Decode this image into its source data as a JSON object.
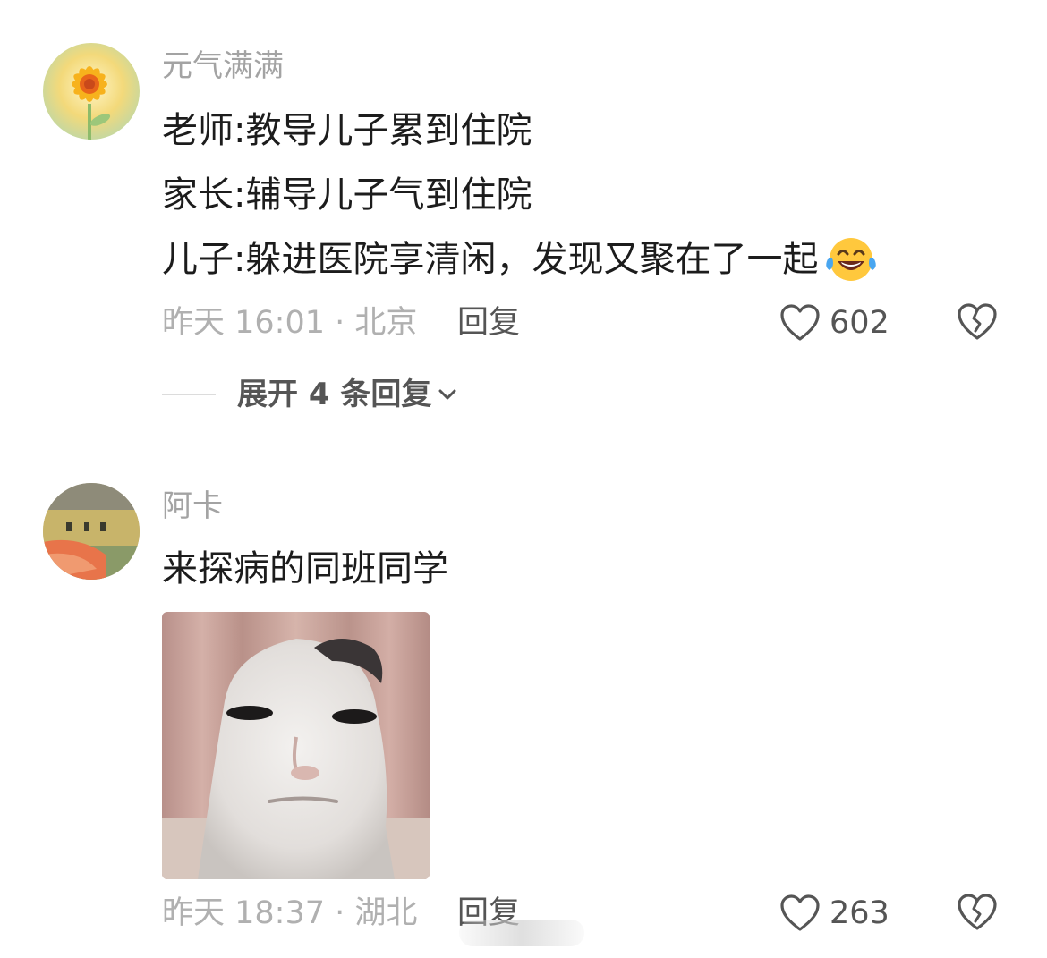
{
  "comments": [
    {
      "username": "元气满满",
      "lines": [
        "老师:教导儿子累到住院",
        "家长:辅导儿子气到住院",
        "儿子:躲进医院享清闲，发现又聚在了一起"
      ],
      "emoji": "tears-of-joy-emoji",
      "time_location": "昨天 16:01 · 北京",
      "reply_label": "回复",
      "likes": "602",
      "expand_replies": "展开 4 条回复"
    },
    {
      "username": "阿卡",
      "lines": [
        "来探病的同班同学"
      ],
      "image": "meme-face-image",
      "time_location": "昨天 18:37 · 湖北",
      "reply_label": "回复",
      "likes": "263"
    }
  ],
  "icons": {
    "like": "heart-outline-icon",
    "dislike": "broken-heart-icon",
    "expand": "chevron-down-icon"
  },
  "colors": {
    "username": "#a3a3a3",
    "body_text": "#1c1c1c",
    "meta_text": "#b0b0b0",
    "action_text": "#555555"
  }
}
